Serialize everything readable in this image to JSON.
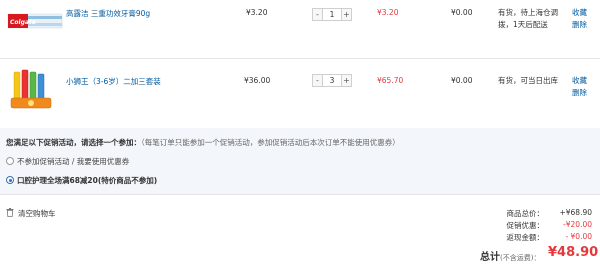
{
  "items": [
    {
      "name": "高露洁 三重功效牙膏90g",
      "brand_text": "Colgate",
      "unit_price": "¥3.20",
      "qty": "1",
      "subtotal": "¥3.20",
      "discount": "¥0.00",
      "stock": "有货，待上海仓调拨，1天后配送",
      "fav": "收藏",
      "del": "删除"
    },
    {
      "name": "小狮王（3-6岁）二加三套装",
      "unit_price": "¥36.00",
      "qty": "3",
      "subtotal": "¥65.70",
      "discount": "¥0.00",
      "stock": "有货，可当日出库",
      "fav": "收藏",
      "del": "删除"
    }
  ],
  "promo": {
    "heading": "您满足以下促销活动，请选择一个参加：",
    "note": "（每笔订单只能参加一个促销活动，参加促销活动后本次订单不能使用优惠券）",
    "options": [
      {
        "label": "不参加促销活动 / 我要使用优惠券",
        "selected": false
      },
      {
        "label": "口腔护理全场满68减20(特价商品不参加)",
        "selected": true
      }
    ]
  },
  "footer": {
    "clear_cart": "清空购物车",
    "summary": [
      {
        "label": "商品总价：",
        "value": "+¥68.90"
      },
      {
        "label": "促销优惠：",
        "value": "-¥20.00"
      },
      {
        "label": "返现金额：",
        "value": "- ¥0.00"
      }
    ],
    "total_label": "总计",
    "total_note": "(不含运费)：",
    "total_value": "¥48.90"
  },
  "colors": {
    "accent_red": "#e4393c",
    "link": "#005aa0",
    "promo_bg": "#f3f6fa"
  }
}
